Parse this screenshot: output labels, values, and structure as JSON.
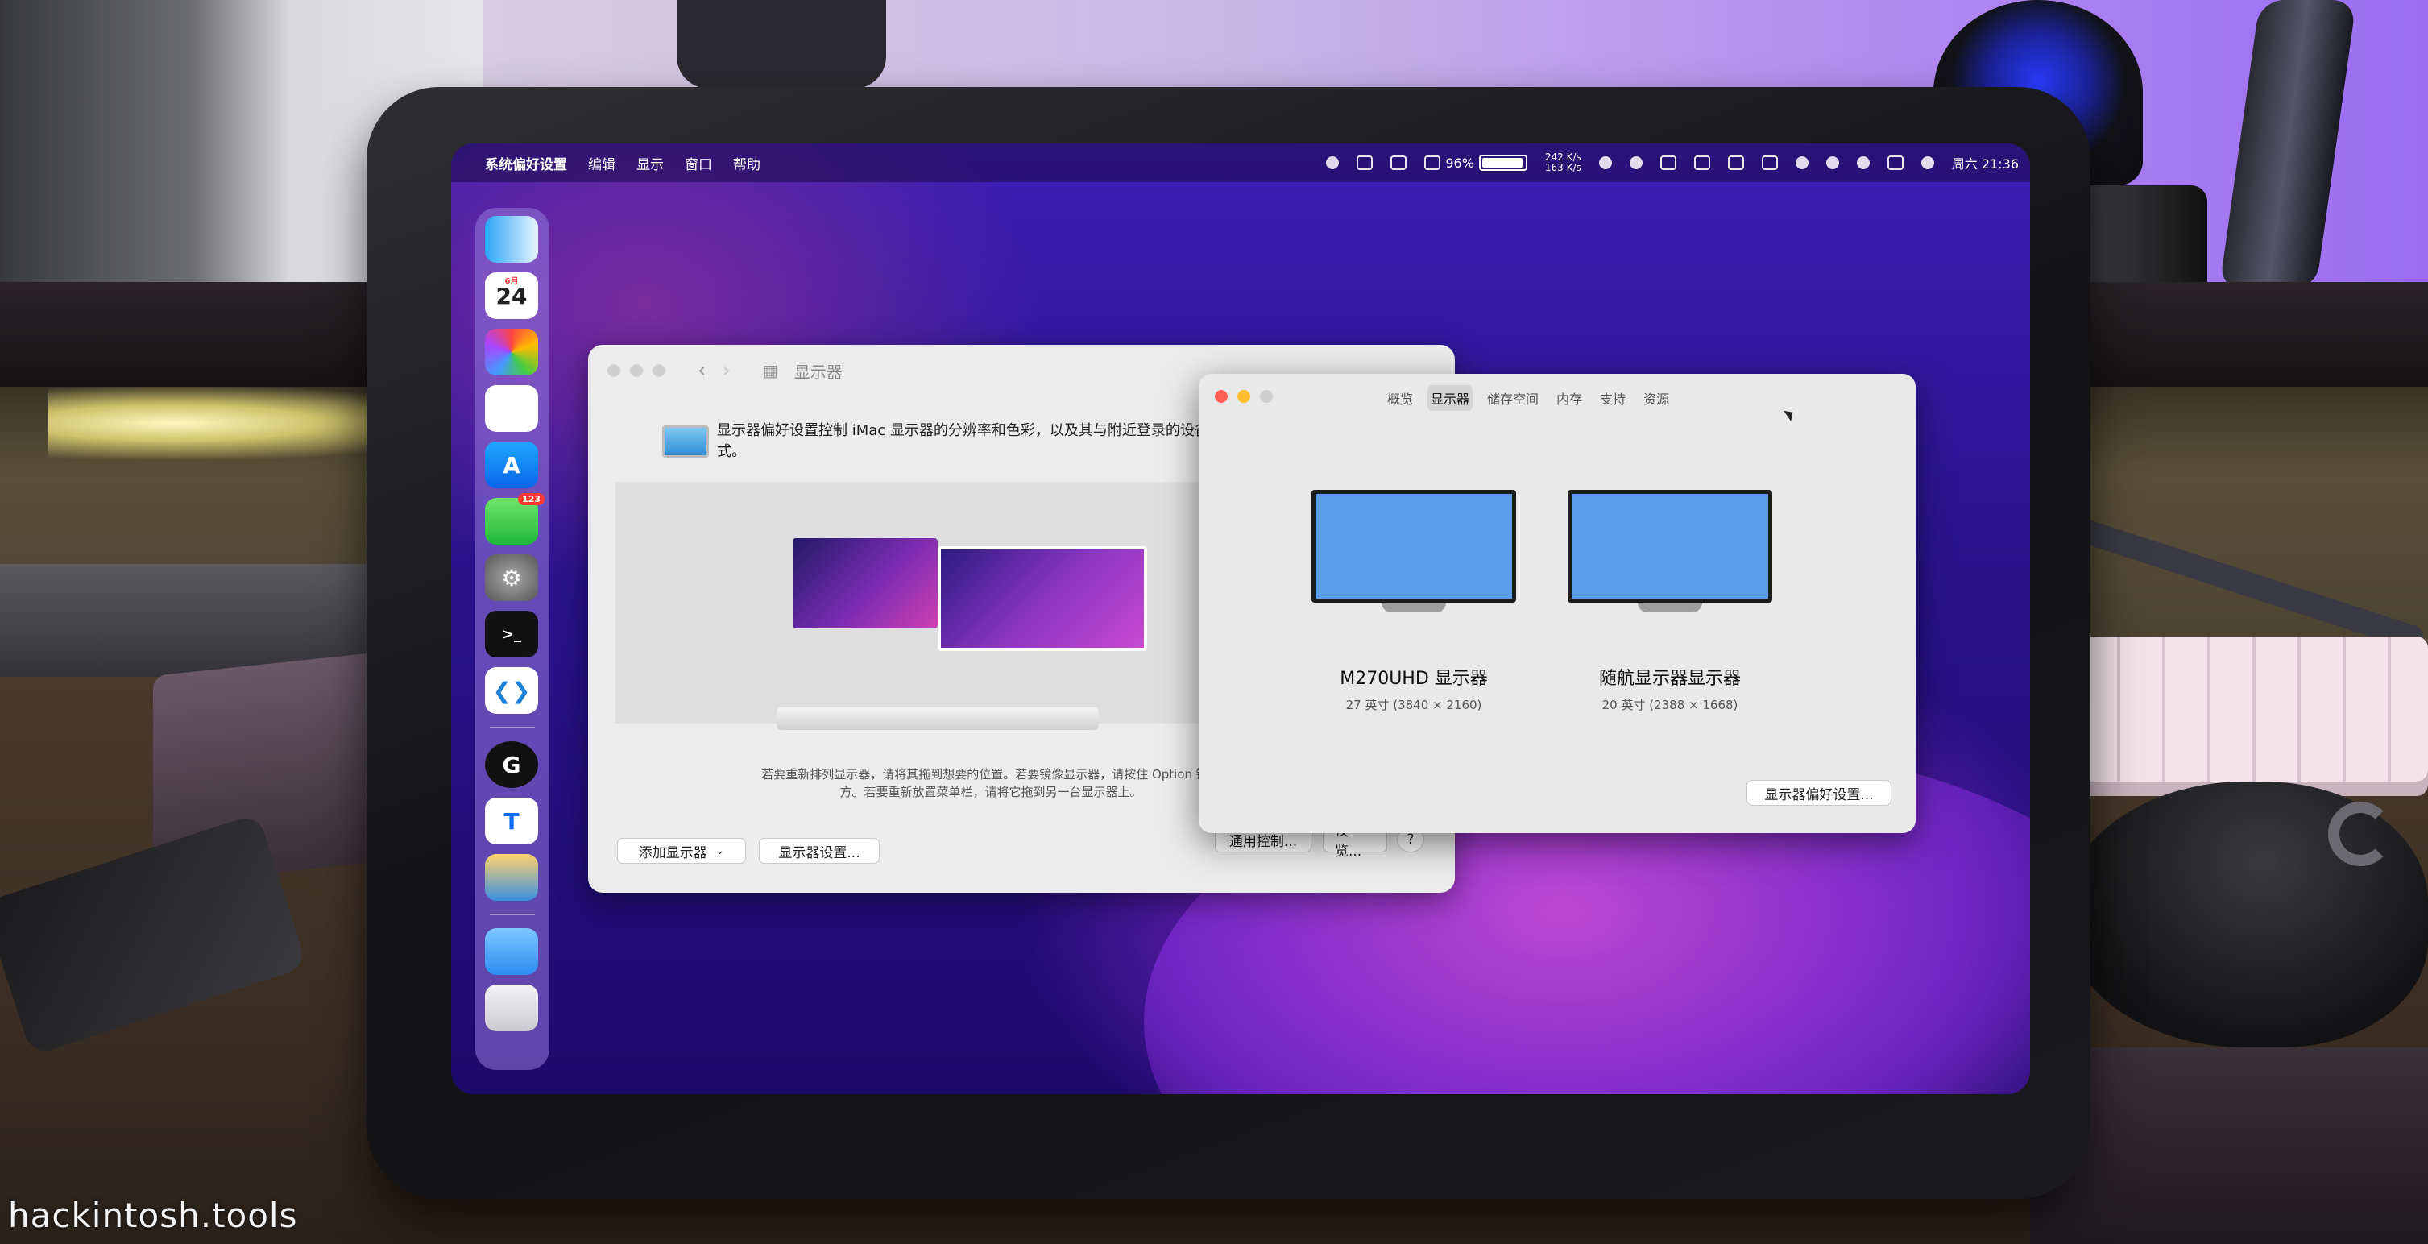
{
  "watermark": "hackintosh.tools",
  "colors": {
    "menubar_bg": "#190a46",
    "window_bg": "#ececec",
    "accent_blue": "#5a9ee8",
    "close_red": "#ff5f57",
    "min_yellow": "#febc2e",
    "max_green": "#28c840"
  },
  "menubar": {
    "apple": "",
    "app": "系统偏好设置",
    "items": [
      "编辑",
      "显示",
      "窗口",
      "帮助"
    ],
    "status": {
      "battery_pct": "96%",
      "battery_level": 0.96,
      "net_up": "242 K/s",
      "net_down": "163 K/s",
      "clock": "周六 21:36"
    }
  },
  "dock": {
    "calendar_month": "6月",
    "calendar_day": "24",
    "messages_badge": "123",
    "items": [
      "finder-icon",
      "calendar-icon",
      "launchpad-icon",
      "reminders-icon",
      "app-store-icon",
      "messages-icon",
      "system-preferences-icon",
      "terminal-icon",
      "vscode-icon",
      "logitech-g-hub-icon",
      "teamviewer-icon",
      "intel-power-gadget-icon",
      "downloads-folder-icon",
      "trash-icon"
    ]
  },
  "prefs_window": {
    "title": "显示器",
    "description": "显示器偏好设置控制 iMac 显示器的分辨率和色彩，以及其与附近登录的设备间的排列方式。",
    "hint_line1": "若要重新排列显示器，请将其拖到想要的位置。若要镜像显示器，请按住 Option 键并",
    "hint_line2": "方。若要重新放置菜单栏，请将它拖到另一台显示器上。",
    "add_display": "添加显示器",
    "display_settings": "显示器设置...",
    "universal_control": "通用控制...",
    "night_shift": "夜览...",
    "help": "?"
  },
  "about_window": {
    "tabs": [
      "概览",
      "显示器",
      "储存空间",
      "内存",
      "支持",
      "资源"
    ],
    "active_tab": "显示器",
    "displays": [
      {
        "name": "M270UHD 显示器",
        "spec": "27 英寸 (3840 × 2160)"
      },
      {
        "name": "随航显示器显示器",
        "spec": "20 英寸 (2388 × 1668)"
      }
    ],
    "prefs_button": "显示器偏好设置..."
  }
}
